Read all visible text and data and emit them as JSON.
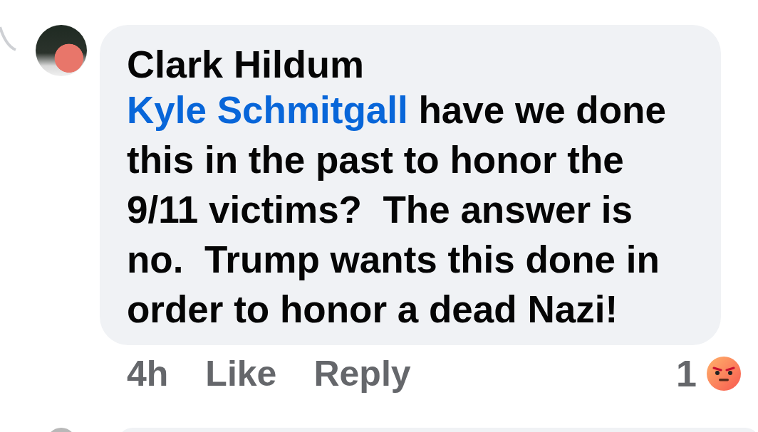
{
  "comment": {
    "author": "Clark Hildum",
    "mention": "Kyle Schmitgall",
    "text": " have we done this in the past to honor the 9/11 victims?  The answer is no.  Trump wants this done in order to honor a dead Nazi!",
    "time": "4h",
    "actions": [
      "Like",
      "Reply"
    ],
    "reaction_count": "1"
  }
}
